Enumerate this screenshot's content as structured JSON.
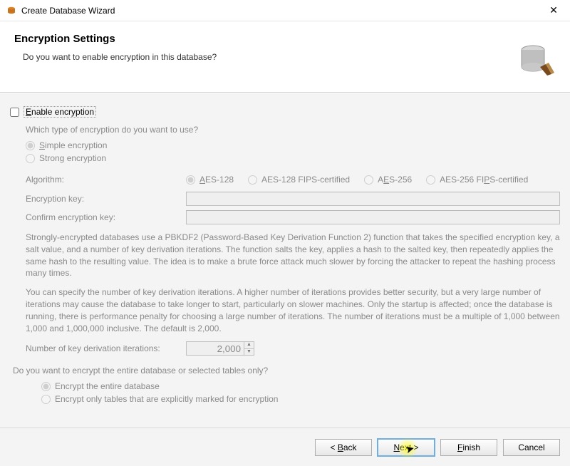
{
  "window": {
    "title": "Create Database Wizard"
  },
  "header": {
    "heading": "Encryption Settings",
    "subtitle": "Do you want to enable encryption in this database?"
  },
  "enable": {
    "label_prefix": "E",
    "label_rest": "nable encryption",
    "checked": false
  },
  "type": {
    "question": "Which type of encryption do you want to use?",
    "simple_u": "S",
    "simple_rest": "imple encryption",
    "strong_u": "",
    "strong": "Strong encryption",
    "strong_rest": ""
  },
  "algorithm": {
    "label": "Algorithm:",
    "opts": {
      "a1_u": "A",
      "a1_rest": "ES-128",
      "a2": "AES-128 FIPS-certified",
      "a3_pre": "A",
      "a3_u": "E",
      "a3_rest": "S-256",
      "a4_pre": "AES-256 FI",
      "a4_u": "P",
      "a4_rest": "S-certified"
    }
  },
  "enckey": {
    "label": "Encryption key:"
  },
  "confkey": {
    "label": "Confirm encryption key:"
  },
  "desc1": "Strongly-encrypted databases use a PBKDF2 (Password-Based Key Derivation Function 2) function that takes the specified encryption key, a salt value, and a number of key derivation iterations. The function salts the key, applies a hash to the salted key, then repeatedly applies the same hash to the resulting value. The idea is to make a brute force attack much slower by forcing the attacker to repeat the hashing process many times.",
  "desc2": "You can specify the number of key derivation iterations. A higher number of iterations provides better security, but a very large number of iterations may cause the database to take longer to start, particularly on slower machines. Only the startup is affected; once the database is running, there is performance penalty for choosing a large number of iterations. The number of iterations must be a multiple of 1,000 between 1,000 and 1,000,000 inclusive. The default is 2,000.",
  "iterations": {
    "label": "Number of key derivation iterations:",
    "value": "2,000"
  },
  "scope": {
    "question": "Do you want to encrypt the entire database or selected tables only?",
    "opt1": "Encrypt the entire database",
    "opt2": "Encrypt only tables that are explicitly marked for encryption"
  },
  "buttons": {
    "back_lt": "<",
    "back_u": "B",
    "back_rest": "ack",
    "next_u": "N",
    "next_rest": "ext",
    "next_gt": ">",
    "finish_u": "F",
    "finish_rest": "inish",
    "cancel": "Cancel"
  }
}
